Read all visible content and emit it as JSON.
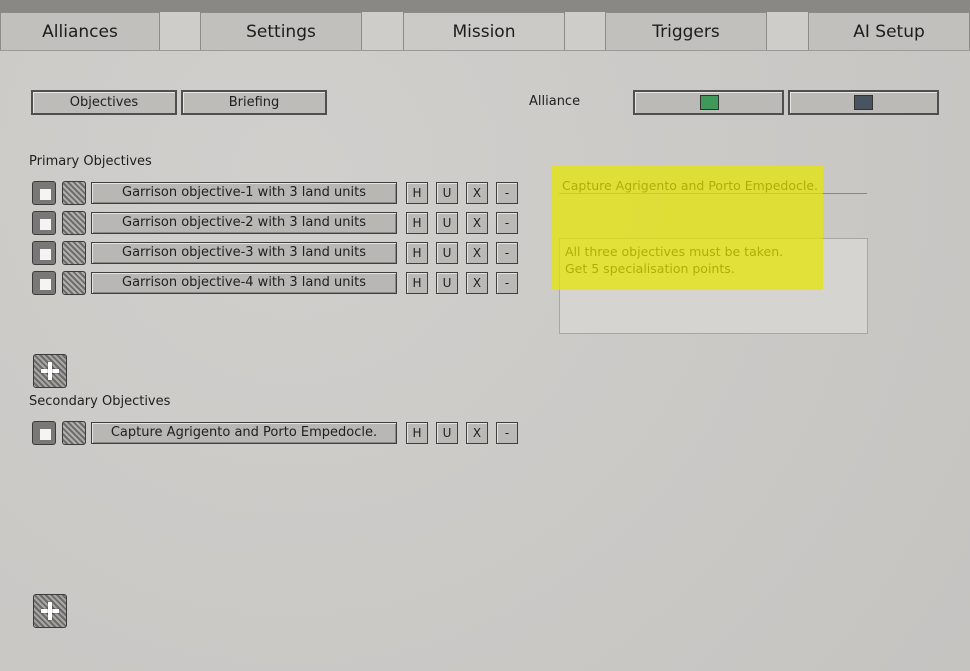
{
  "tabs": [
    {
      "label": "Alliances"
    },
    {
      "label": "Settings"
    },
    {
      "label": "Mission"
    },
    {
      "label": "Triggers"
    },
    {
      "label": "AI Setup"
    }
  ],
  "active_tab": "Mission",
  "subtabs": {
    "objectives": "Objectives",
    "briefing": "Briefing"
  },
  "alliance": {
    "label": "Alliance",
    "colors": [
      "#3f9a5a",
      "#4a5460"
    ]
  },
  "primary": {
    "heading": "Primary Objectives",
    "items": [
      {
        "text": "Garrison objective-1 with 3 land units"
      },
      {
        "text": "Garrison objective-2 with 3 land units"
      },
      {
        "text": "Garrison objective-3 with 3 land units"
      },
      {
        "text": "Garrison objective-4 with 3 land units"
      }
    ]
  },
  "secondary": {
    "heading": "Secondary Objectives",
    "items": [
      {
        "text": "Capture Agrigento and Porto Empedocle."
      }
    ]
  },
  "row_buttons": {
    "h": "H",
    "u": "U",
    "x": "X",
    "minus": "-"
  },
  "detail": {
    "title": "Capture Agrigento and Porto Empedocle.",
    "description_lines": [
      "All three objectives must be taken.",
      "Get 5 specialisation points."
    ]
  },
  "highlight_color": "#e6e600"
}
